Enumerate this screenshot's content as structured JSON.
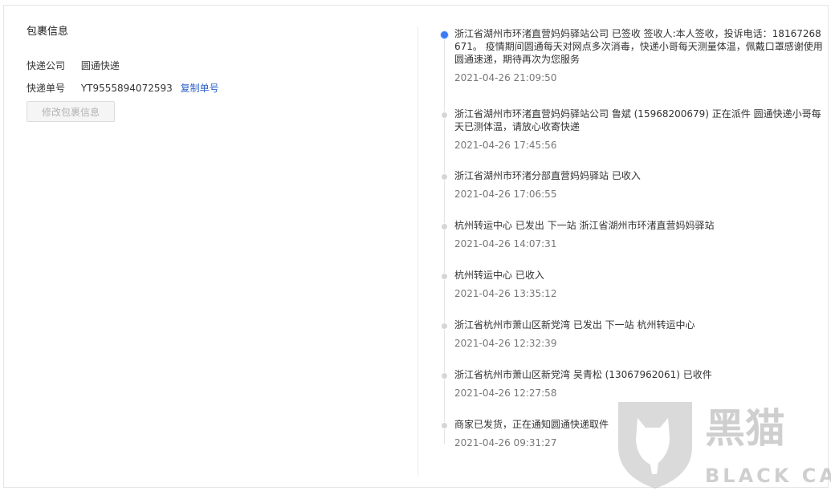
{
  "package": {
    "title": "包裹信息",
    "courier_label": "快递公司",
    "courier_value": "圆通快递",
    "tracking_label": "快递单号",
    "tracking_value": "YT9555894072593",
    "copy_label": "复制单号",
    "edit_button": "修改包裹信息"
  },
  "timeline": [
    {
      "text": "浙江省湖州市环渚直营妈妈驿站公司 已签收 签收人:本人签收，投诉电话：18167268671。 疫情期间圆通每天对网点多次消毒，快递小哥每天测量体温，佩戴口罩感谢使用圆通速递，期待再次为您服务",
      "time": "2021-04-26 21:09:50"
    },
    {
      "text": "浙江省湖州市环渚直营妈妈驿站公司 鲁斌 (15968200679) 正在派件 圆通快递小哥每天已测体温，请放心收寄快递",
      "time": "2021-04-26 17:45:56"
    },
    {
      "text": "浙江省湖州市环渚分部直营妈妈驿站 已收入",
      "time": "2021-04-26 17:06:55"
    },
    {
      "text": "杭州转运中心 已发出 下一站 浙江省湖州市环渚直营妈妈驿站",
      "time": "2021-04-26 14:07:31"
    },
    {
      "text": "杭州转运中心 已收入",
      "time": "2021-04-26 13:35:12"
    },
    {
      "text": "浙江省杭州市萧山区新党湾 已发出 下一站 杭州转运中心",
      "time": "2021-04-26 12:32:39"
    },
    {
      "text": "浙江省杭州市萧山区新党湾 吴青松 (13067962061) 已收件",
      "time": "2021-04-26 12:27:58"
    },
    {
      "text": "商家已发货，正在通知圆通快递取件",
      "time": "2021-04-26 09:31:27"
    }
  ],
  "watermark": {
    "cn": "黑猫",
    "en": "BLACK CAT"
  },
  "colors": {
    "accent": "#3a7af5",
    "link": "#2f64c8"
  }
}
